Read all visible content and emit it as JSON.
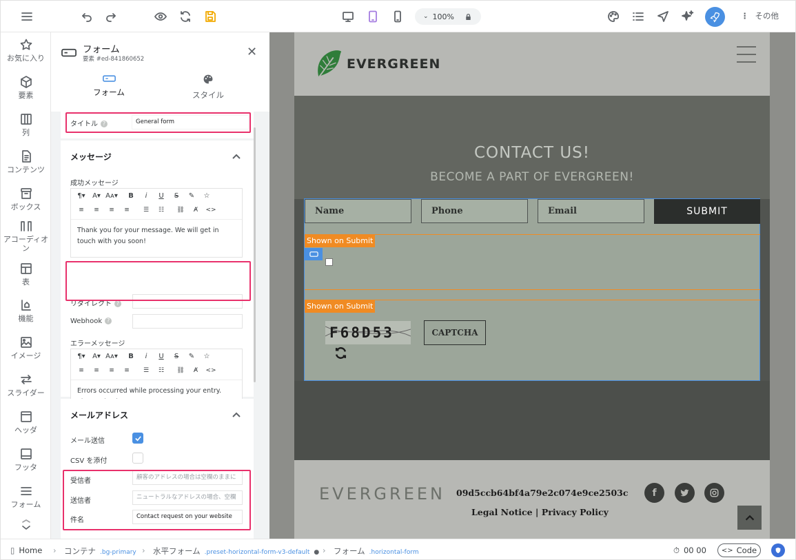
{
  "toolbar": {
    "zoom": "100%",
    "more_label": "その他"
  },
  "nav": [
    {
      "label": "お気に入り",
      "icon": "star-icon"
    },
    {
      "label": "要素",
      "icon": "cube-icon"
    },
    {
      "label": "列",
      "icon": "columns-icon"
    },
    {
      "label": "コンテンツ",
      "icon": "document-icon"
    },
    {
      "label": "ボックス",
      "icon": "box-icon"
    },
    {
      "label": "アコーディオン",
      "icon": "accordion-icon"
    },
    {
      "label": "表",
      "icon": "table-icon"
    },
    {
      "label": "機能",
      "icon": "function-icon"
    },
    {
      "label": "イメージ",
      "icon": "image-icon"
    },
    {
      "label": "スライダー",
      "icon": "slider-icon"
    },
    {
      "label": "ヘッダ",
      "icon": "header-icon"
    },
    {
      "label": "フッタ",
      "icon": "footer-icon"
    },
    {
      "label": "フォーム",
      "icon": "form-icon"
    }
  ],
  "panel": {
    "title": "フォーム",
    "subtitle": "要素 #ed-841860652",
    "tabs": [
      {
        "label": "フォーム"
      },
      {
        "label": "スタイル"
      }
    ],
    "form_title_label": "タイトル",
    "form_title_value": "General form",
    "message_section": "メッセージ",
    "success_label": "成功メッセージ",
    "success_text": "Thank you for your message. We will get in touch with you soon!",
    "redirect_label": "リダイレクト",
    "webhook_label": "Webhook",
    "error_label": "エラーメッセージ",
    "error_text": "Errors occurred while processing your entry. Please check your entry.",
    "email_section": "メールアドレス",
    "send_mail_label": "メール送信",
    "send_mail_checked": true,
    "csv_label": "CSV を添付",
    "csv_checked": false,
    "recipient_label": "受信者",
    "recipient_placeholder": "顧客のアドレスの場合は空欄のままに",
    "sender_label": "送信者",
    "sender_placeholder": "ニュートラルなアドレスの場合、空欄",
    "subject_label": "件名",
    "subject_value": "Contact request on your website"
  },
  "preview": {
    "brand": "EVERGREEN",
    "hero_title": "CONTACT US!",
    "hero_subtitle": "BECOME A PART OF EVERGREEN!",
    "fields": [
      "Name",
      "Phone",
      "Email"
    ],
    "submit": "SUBMIT",
    "shown_on_submit_1": "Shown on Submit",
    "shown_on_submit_2": "Shown on Submit",
    "captcha_code": "F68D53",
    "captcha_button": "CAPTCHA",
    "footer_brand": "EVERGREEN",
    "footer_hash": "09d5ccb64bf4a79e2c074e9ce2503c",
    "footer_link_1": "Legal Notice",
    "footer_sep": "|",
    "footer_link_2": "Privacy Policy"
  },
  "statusbar": {
    "home": "Home",
    "c1": "コンテナ",
    "c1_cls": ".bg-primary",
    "c2": "水平フォーム",
    "c2_cls": ".preset-horizontal-form-v3-default",
    "c3": "フォーム",
    "c3_cls": ".horizontal-form",
    "timer": "00 00",
    "code": "Code"
  }
}
